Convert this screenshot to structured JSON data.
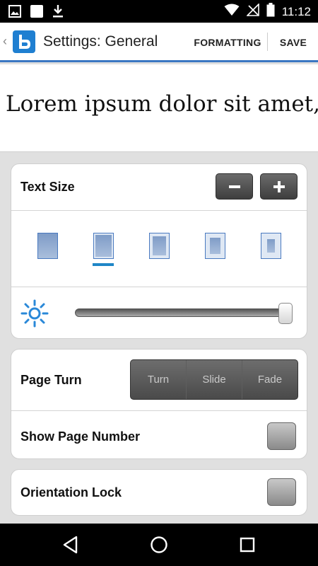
{
  "status_bar": {
    "time": "11:12",
    "left_icons": [
      "image-notification-icon",
      "square-notification-icon",
      "download-icon"
    ],
    "right_icons": [
      "wifi-icon",
      "no-signal-icon",
      "battery-icon"
    ]
  },
  "app_bar": {
    "title": "Settings: General",
    "formatting_label": "FORMATTING",
    "save_label": "SAVE",
    "logo_letter": "b"
  },
  "preview": {
    "text": "Lorem ipsum dolor sit amet,"
  },
  "text_size": {
    "label": "Text Size",
    "decrease_symbol": "−",
    "increase_symbol": "+",
    "options_count": 5,
    "selected_index": 1
  },
  "brightness": {
    "icon": "brightness-icon",
    "level": 1.0
  },
  "page_turn": {
    "label": "Page Turn",
    "options": [
      "Turn",
      "Slide",
      "Fade"
    ]
  },
  "show_page_number": {
    "label": "Show Page Number",
    "checked": false
  },
  "orientation_lock": {
    "label": "Orientation Lock",
    "checked": false
  },
  "nav_bar": {
    "icons": [
      "back-icon",
      "home-icon",
      "recents-icon"
    ]
  },
  "colors": {
    "accent": "#1f86c7",
    "app_bar_border": "#3b77c2",
    "logo": "#1f7fd1"
  }
}
